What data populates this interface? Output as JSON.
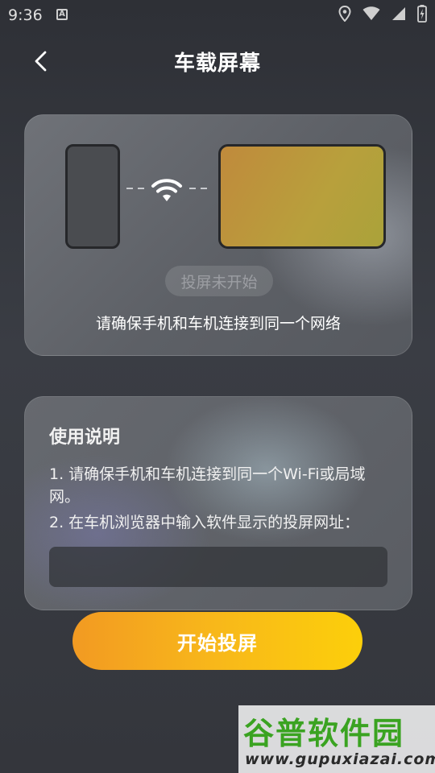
{
  "status_bar": {
    "time": "9:36",
    "notification_glyph": "A",
    "icons": [
      "location-icon",
      "wifi-signal-icon",
      "cell-signal-icon",
      "battery-icon"
    ]
  },
  "header": {
    "title": "车载屏幕",
    "back_icon": "chevron-left-icon"
  },
  "connection_card": {
    "status": "投屏未开始",
    "tip": "请确保手机和车机连接到同一个网络"
  },
  "instructions": {
    "title": "使用说明",
    "step1": "1. 请确保手机和车机连接到同一个Wi-Fi或局域网。",
    "step2": "2. 在车机浏览器中输入软件显示的投屏网址：",
    "url": ""
  },
  "start_button": {
    "label": "开始投屏"
  },
  "watermark": {
    "title": "谷普软件园",
    "url": "www.gupuxiazai.com"
  },
  "colors": {
    "accent_start": "#f29a22",
    "accent_end": "#fccf0a",
    "watermark_green": "#3aa321"
  }
}
